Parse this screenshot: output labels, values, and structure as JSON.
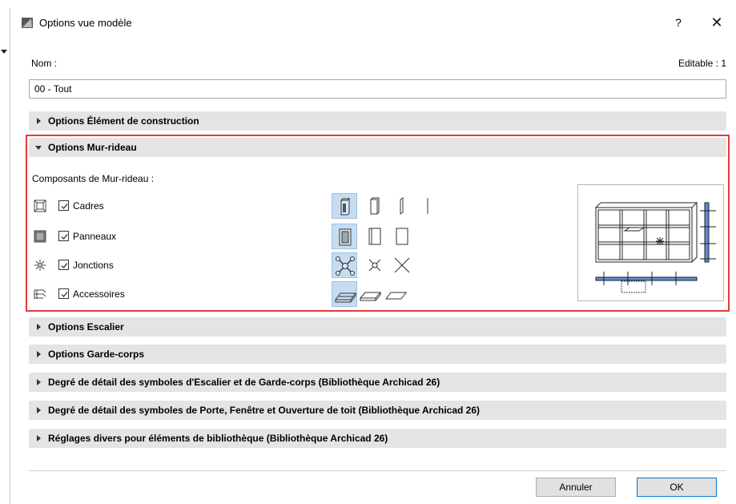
{
  "window": {
    "title": "Options vue modèle",
    "help_label": "?",
    "close_label": "✕"
  },
  "name": {
    "label": "Nom :",
    "editable_label": "Editable : 1",
    "value": "00 - Tout"
  },
  "sections": [
    {
      "label": "Options Élément de construction",
      "expanded": false
    },
    {
      "label": "Options Mur-rideau",
      "expanded": true
    },
    {
      "label": "Options Escalier",
      "expanded": false
    },
    {
      "label": "Options Garde-corps",
      "expanded": false
    },
    {
      "label": "Degré de détail des symboles d'Escalier et de Garde-corps (Bibliothèque Archicad 26)",
      "expanded": false
    },
    {
      "label": "Degré de détail des symboles de Porte, Fenêtre et Ouverture de toit (Bibliothèque Archicad 26)",
      "expanded": false
    },
    {
      "label": "Réglages divers pour éléments de bibliothèque (Bibliothèque Archicad 26)",
      "expanded": false
    }
  ],
  "curtain_wall": {
    "components_label": "Composants de Mur-rideau :",
    "components": [
      {
        "label": "Cadres",
        "checked": true,
        "icon": "frame-icon",
        "options": [
          "frame-full-icon",
          "frame-profile-icon",
          "frame-thin-icon",
          "frame-line-icon"
        ],
        "selected": 0
      },
      {
        "label": "Panneaux",
        "checked": true,
        "icon": "panel-icon",
        "options": [
          "panel-full-icon",
          "panel-outline-icon",
          "panel-simple-icon"
        ],
        "selected": 0
      },
      {
        "label": "Jonctions",
        "checked": true,
        "icon": "junction-icon",
        "options": [
          "junction-full-icon",
          "junction-simple-icon",
          "junction-cross-icon"
        ],
        "selected": 0
      },
      {
        "label": "Accessoires",
        "checked": true,
        "icon": "accessory-icon",
        "options": [
          "accessory-full-icon",
          "accessory-simple-icon",
          "accessory-outline-icon"
        ],
        "selected": 0
      }
    ]
  },
  "buttons": {
    "cancel": "Annuler",
    "ok": "OK"
  },
  "colors": {
    "highlight_border": "#e53a3a",
    "section_bg": "#e4e4e4",
    "selected_option_bg": "#c6dcf1",
    "ok_border": "#0078d7"
  }
}
